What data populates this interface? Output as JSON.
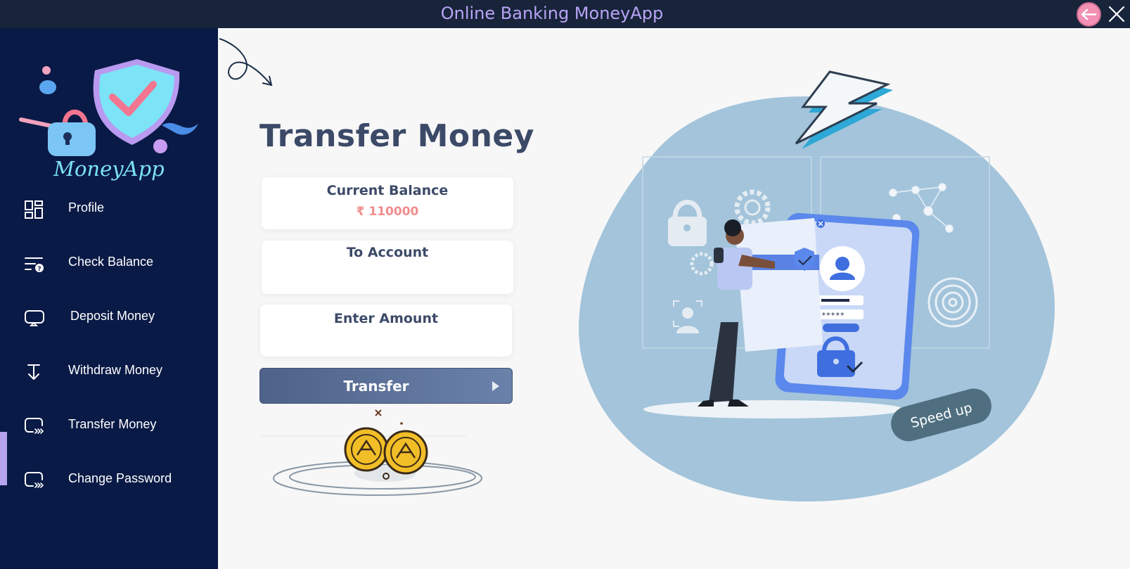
{
  "window": {
    "title": "Online Banking MoneyApp"
  },
  "sidebar": {
    "brand": "MoneyApp",
    "items": [
      {
        "label": "Profile",
        "icon": "dashboard-icon"
      },
      {
        "label": "Check Balance",
        "icon": "balance-list-icon"
      },
      {
        "label": "Deposit Money",
        "icon": "deposit-icon"
      },
      {
        "label": "Withdraw Money",
        "icon": "withdraw-arrow-icon"
      },
      {
        "label": "Transfer Money",
        "icon": "transfer-icon",
        "active": true
      },
      {
        "label": "Change Password",
        "icon": "password-icon"
      }
    ]
  },
  "main": {
    "title": "Transfer Money",
    "balance_label": "Current Balance",
    "balance_value": "₹ 110000",
    "to_account_label": "To Account",
    "to_account_value": "",
    "amount_label": "Enter Amount",
    "amount_value": "",
    "transfer_label": "Transfer"
  },
  "illustration": {
    "badge": "Speed up"
  },
  "colors": {
    "titlebar": "#17243a",
    "sidebar": "#0a1a46",
    "accent": "#b6a4ee",
    "balance": "#f18d8d",
    "heading": "#3c4a68",
    "blob": "#a3c4db",
    "button": "#5a6f97"
  }
}
